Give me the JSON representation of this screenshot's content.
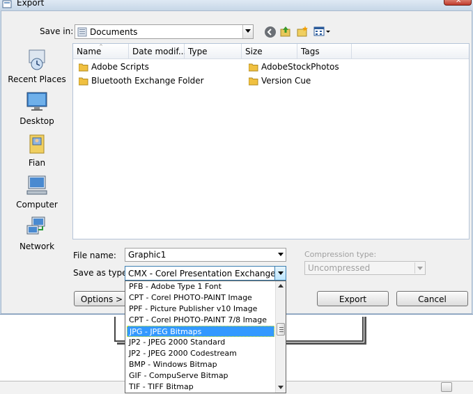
{
  "window": {
    "title": "Export"
  },
  "toolbar": {
    "save_in_label": "Save in:",
    "save_in_value": "Documents"
  },
  "places": [
    {
      "label": "Recent Places",
      "icon": "recent-places-icon"
    },
    {
      "label": "Desktop",
      "icon": "desktop-icon"
    },
    {
      "label": "Fian",
      "icon": "user-folder-icon"
    },
    {
      "label": "Computer",
      "icon": "computer-icon"
    },
    {
      "label": "Network",
      "icon": "network-icon"
    }
  ],
  "columns": [
    "Name",
    "Date modif...",
    "Type",
    "Size",
    "Tags"
  ],
  "files": [
    {
      "name": "Adobe Scripts"
    },
    {
      "name": "Bluetooth Exchange Folder"
    },
    {
      "name": "AdobeStockPhotos"
    },
    {
      "name": "Version Cue"
    }
  ],
  "form": {
    "file_name_label": "File name:",
    "file_name_value": "Graphic1",
    "save_as_label": "Save as type:",
    "save_as_value": "CMX - Corel Presentation Exchange",
    "compression_label": "Compression type:",
    "compression_value": "Uncompressed"
  },
  "buttons": {
    "options": "Options >",
    "export": "Export",
    "cancel": "Cancel"
  },
  "type_options": [
    "PFB - Adobe Type 1 Font",
    "CPT - Corel PHOTO-PAINT Image",
    "PPF - Picture Publisher v10 Image",
    "CPT - Corel PHOTO-PAINT 7/8 Image",
    "JPG - JPEG Bitmaps",
    "JP2 - JPEG 2000 Standard",
    "JP2 - JPEG 2000 Codestream",
    "BMP - Windows Bitmap",
    "GIF - CompuServe Bitmap",
    "TIF - TIFF Bitmap"
  ],
  "selected_type_option": "JPG - JPEG Bitmaps",
  "colors": {
    "selection": "#3399ff",
    "title_bar": "#c8d8e8",
    "close_button": "#c0392b"
  }
}
